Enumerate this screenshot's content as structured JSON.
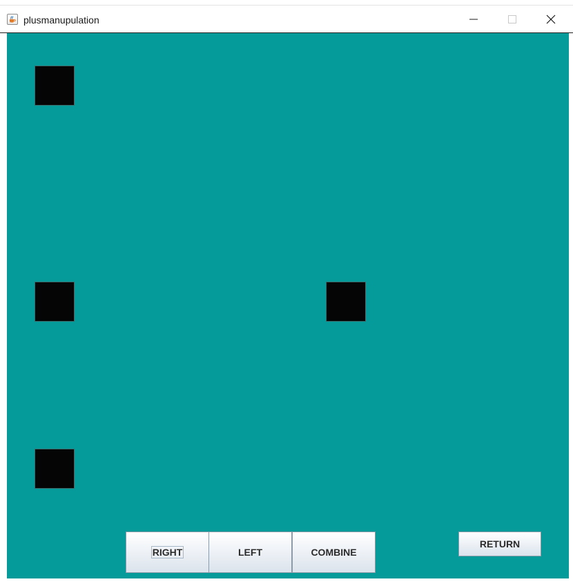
{
  "window": {
    "title": "plusmanupulation",
    "icon": "java-coffee-cup-icon"
  },
  "titlebar_controls": {
    "minimize_icon": "minimize-icon",
    "maximize_icon": "maximize-icon",
    "close_icon": "close-icon"
  },
  "canvas": {
    "background_color": "#069b9b",
    "tile_color": "#050505",
    "tile_count": 4
  },
  "buttons": {
    "right": "RIGHT",
    "left": "LEFT",
    "combine": "COMBINE",
    "return": "RETURN"
  }
}
